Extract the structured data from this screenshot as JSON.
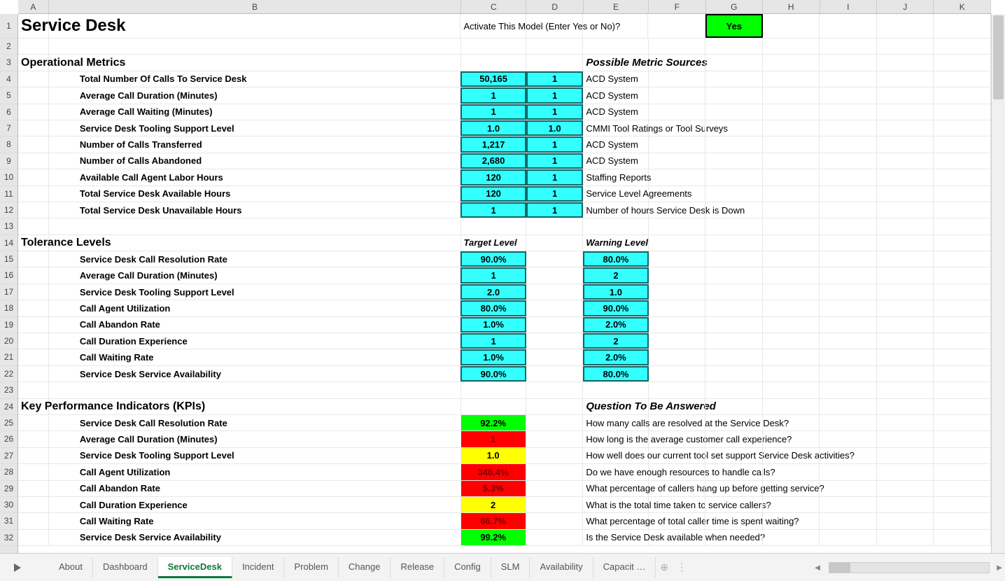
{
  "columns": [
    "A",
    "B",
    "C",
    "D",
    "E",
    "F",
    "G",
    "H",
    "I",
    "J",
    "K"
  ],
  "rowcount": 32,
  "title": "Service Desk",
  "activate_prompt": "Activate This Model (Enter Yes or No)?",
  "activate_value": "Yes",
  "sections": {
    "ops_header": "Operational Metrics",
    "ops_source_header": "Possible Metric Sources",
    "tol_header": "Tolerance Levels",
    "tol_target": "Target Level",
    "tol_warning": "Warning Level",
    "kpi_header": "Key Performance Indicators (KPIs)",
    "kpi_q": "Question To Be Answered"
  },
  "ops": [
    {
      "label": "Total Number Of Calls To Service Desk",
      "c": "50,165",
      "d": "1",
      "src": "ACD System"
    },
    {
      "label": "Average Call Duration (Minutes)",
      "c": "1",
      "d": "1",
      "src": "ACD System"
    },
    {
      "label": "Average Call Waiting (Minutes)",
      "c": "1",
      "d": "1",
      "src": "ACD System"
    },
    {
      "label": "Service Desk Tooling Support Level",
      "c": "1.0",
      "d": "1.0",
      "src": "CMMI Tool Ratings or Tool Surveys"
    },
    {
      "label": "Number of Calls Transferred",
      "c": "1,217",
      "d": "1",
      "src": "ACD System"
    },
    {
      "label": "Number of Calls Abandoned",
      "c": "2,680",
      "d": "1",
      "src": "ACD System"
    },
    {
      "label": "Available Call Agent Labor Hours",
      "c": "120",
      "d": "1",
      "src": "Staffing Reports"
    },
    {
      "label": "Total Service Desk Available Hours",
      "c": "120",
      "d": "1",
      "src": "Service Level Agreements"
    },
    {
      "label": "Total Service Desk Unavailable Hours",
      "c": "1",
      "d": "1",
      "src": "Number of hours Service Desk is Down"
    }
  ],
  "tol": [
    {
      "label": "Service Desk Call Resolution Rate",
      "c": "90.0%",
      "e": "80.0%"
    },
    {
      "label": "Average Call Duration (Minutes)",
      "c": "1",
      "e": "2"
    },
    {
      "label": "Service Desk Tooling Support Level",
      "c": "2.0",
      "e": "1.0"
    },
    {
      "label": "Call Agent Utilization",
      "c": "80.0%",
      "e": "90.0%"
    },
    {
      "label": "Call Abandon Rate",
      "c": "1.0%",
      "e": "2.0%"
    },
    {
      "label": "Call Duration Experience",
      "c": "1",
      "e": "2"
    },
    {
      "label": "Call Waiting Rate",
      "c": "1.0%",
      "e": "2.0%"
    },
    {
      "label": "Service Desk Service Availability",
      "c": "90.0%",
      "e": "80.0%"
    }
  ],
  "kpi": [
    {
      "label": "Service Desk Call Resolution Rate",
      "c": "92.2%",
      "color": "green",
      "q": "How many calls are resolved at the Service Desk?"
    },
    {
      "label": "Average Call Duration (Minutes)",
      "c": "1",
      "color": "red",
      "q": "How long is the average customer call experience?"
    },
    {
      "label": "Service Desk Tooling Support Level",
      "c": "1.0",
      "color": "yellow",
      "q": "How well does our current tool set support Service Desk activities?"
    },
    {
      "label": "Call Agent Utilization",
      "c": "348.4%",
      "color": "red",
      "q": "Do we have enough resources to handle calls?"
    },
    {
      "label": "Call Abandon Rate",
      "c": "5.3%",
      "color": "red",
      "q": "What percentage of callers hang up before getting service?"
    },
    {
      "label": "Call Duration Experience",
      "c": "2",
      "color": "yellow",
      "q": "What is the total time taken to service callers?"
    },
    {
      "label": "Call Waiting Rate",
      "c": "66.7%",
      "color": "red",
      "q": "What percentage of total caller time is spent waiting?"
    },
    {
      "label": "Service Desk Service Availability",
      "c": "99.2%",
      "color": "green",
      "q": "Is the Service Desk available when needed?"
    }
  ],
  "tabs": [
    "About",
    "Dashboard",
    "ServiceDesk",
    "Incident",
    "Problem",
    "Change",
    "Release",
    "Config",
    "SLM",
    "Availability",
    "Capacit …"
  ],
  "active_tab": "ServiceDesk"
}
